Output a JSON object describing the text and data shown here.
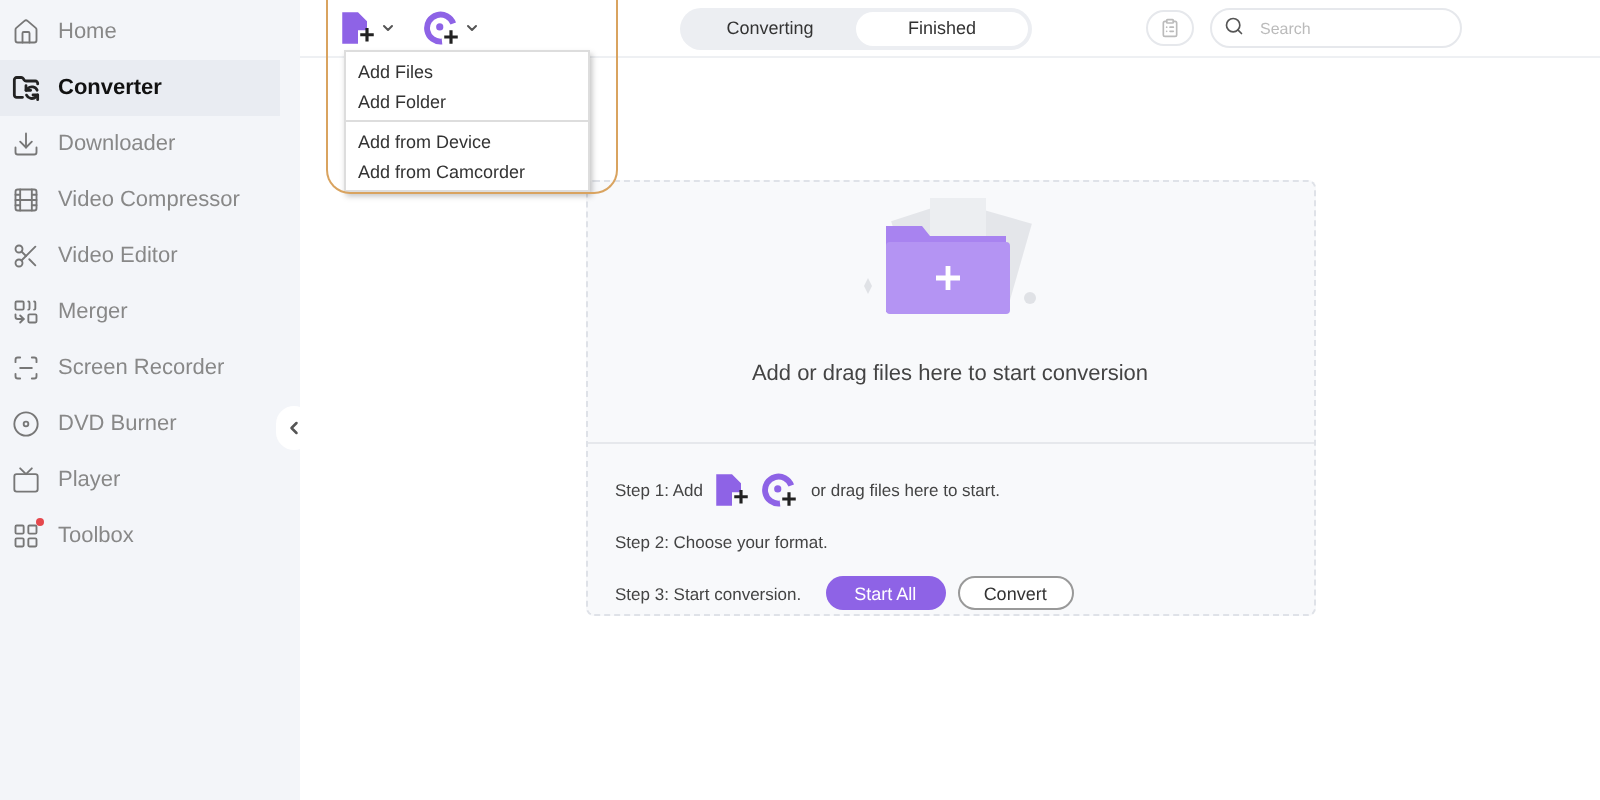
{
  "sidebar": {
    "items": [
      {
        "label": "Home",
        "selected": false
      },
      {
        "label": "Converter",
        "selected": true
      },
      {
        "label": "Downloader",
        "selected": false
      },
      {
        "label": "Video Compressor",
        "selected": false
      },
      {
        "label": "Video Editor",
        "selected": false
      },
      {
        "label": "Merger",
        "selected": false
      },
      {
        "label": "Screen Recorder",
        "selected": false
      },
      {
        "label": "DVD Burner",
        "selected": false
      },
      {
        "label": "Player",
        "selected": false
      },
      {
        "label": "Toolbox",
        "selected": false,
        "badge": true
      }
    ]
  },
  "add_menu": {
    "items": [
      {
        "label": "Add Files",
        "separator_before": false
      },
      {
        "label": "Add Folder",
        "separator_before": false
      },
      {
        "label": "Add from Device",
        "separator_before": true
      },
      {
        "label": "Add from Camcorder",
        "separator_before": false
      }
    ]
  },
  "tabs": [
    {
      "label": "Converting",
      "selected": false
    },
    {
      "label": "Finished",
      "selected": true
    }
  ],
  "search": {
    "placeholder": "Search"
  },
  "drop_zone": {
    "message": "Add or drag files here to start conversion",
    "step1_before": "Step 1: Add",
    "step1_after": "or drag files here to start.",
    "step2": "Step 2: Choose your format.",
    "step3": "Step 3: Start conversion.",
    "start_all": "Start All",
    "convert": "Convert"
  }
}
